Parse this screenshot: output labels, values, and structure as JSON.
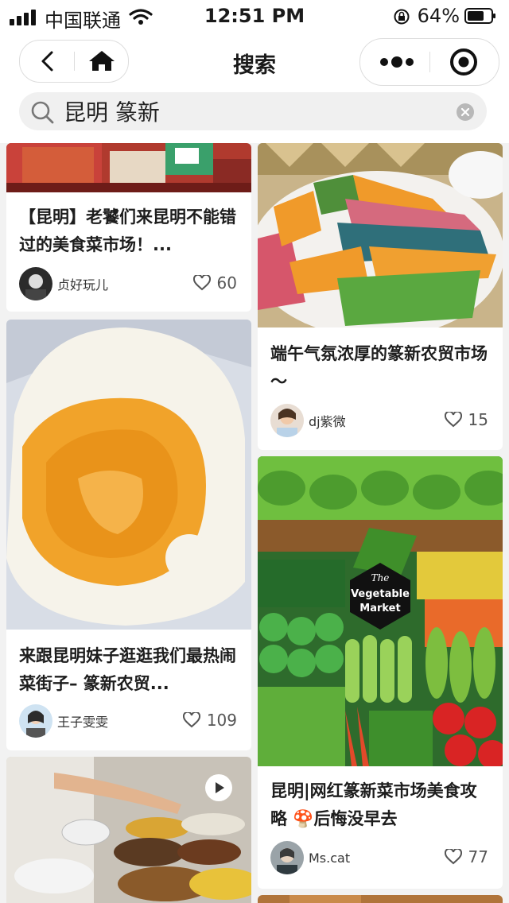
{
  "status_bar": {
    "carrier": "中国联通",
    "time": "12:51 PM",
    "battery": "64%"
  },
  "nav": {
    "title": "搜索"
  },
  "search": {
    "query": "昆明 篆新"
  },
  "cards": [
    {
      "title": "【昆明】老饕们来昆明不能错过的美食菜市场！...",
      "author": "贞好玩儿",
      "likes": "60"
    },
    {
      "title": "端午气氛浓厚的篆新农贸市场～",
      "author": "dj紫微",
      "likes": "15"
    },
    {
      "title": "来跟昆明妹子逛逛我们最热闹菜街子– 篆新农贸...",
      "author": "王子雯雯",
      "likes": "109"
    },
    {
      "title": "昆明|网红篆新菜市场美食攻略 🍄后悔没早去",
      "author": "Ms.cat",
      "likes": "77",
      "badge_line1": "The",
      "badge_line2": "Vegetable",
      "badge_line3": "Market"
    }
  ],
  "colors": {
    "accent": "#111111",
    "background": "#f2f2f2"
  }
}
